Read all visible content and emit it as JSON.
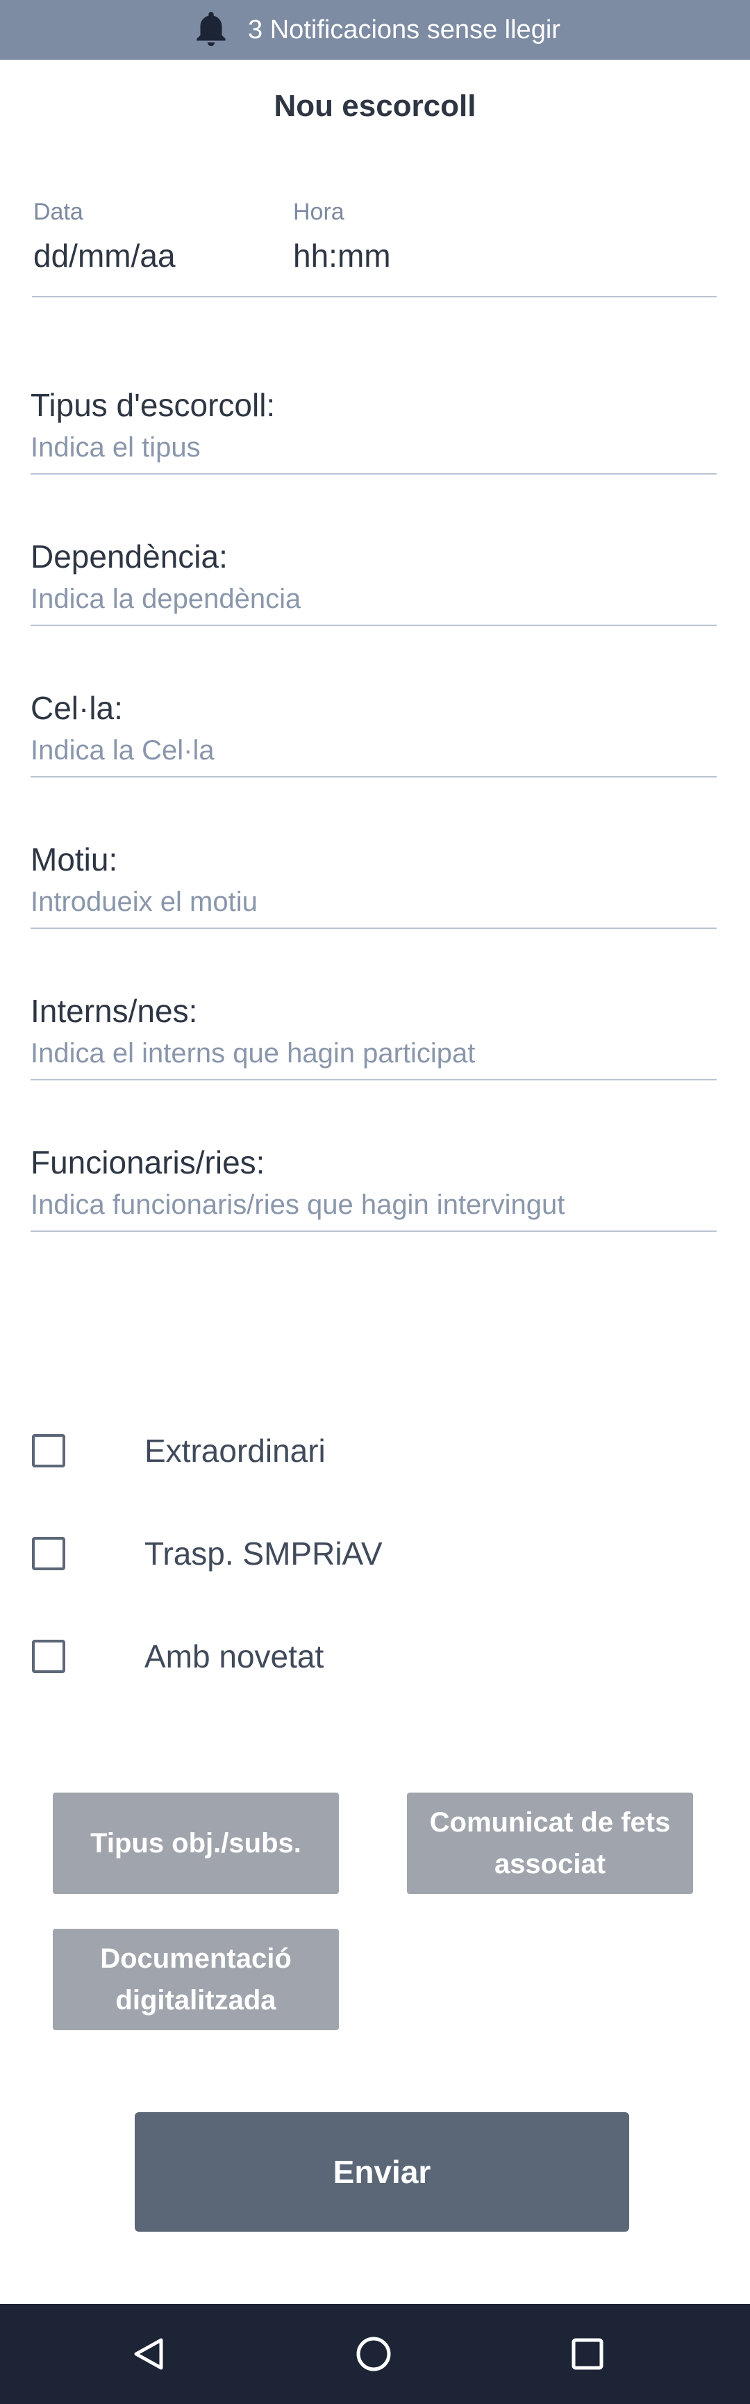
{
  "notification_bar": {
    "icon": "bell-icon",
    "text": "3 Notificacions sense llegir"
  },
  "page_title": "Nou escorcoll",
  "datetime": {
    "date_label": "Data",
    "date_value": "dd/mm/aa",
    "time_label": "Hora",
    "time_value": "hh:mm"
  },
  "fields": [
    {
      "label": "Tipus d'escorcoll:",
      "placeholder": "Indica el tipus"
    },
    {
      "label": "Dependència:",
      "placeholder": "Indica la dependència"
    },
    {
      "label": "Cel·la:",
      "placeholder": "Indica la Cel·la"
    },
    {
      "label": "Motiu:",
      "placeholder": "Introdueix el motiu"
    },
    {
      "label": "Interns/nes:",
      "placeholder": "Indica el interns que hagin participat"
    },
    {
      "label": "Funcionaris/ries:",
      "placeholder": "Indica funcionaris/ries que hagin intervingut"
    }
  ],
  "checkboxes": [
    {
      "label": "Extraordinari",
      "checked": false
    },
    {
      "label": "Trasp. SMPRiAV",
      "checked": false
    },
    {
      "label": "Amb novetat",
      "checked": false
    }
  ],
  "buttons": {
    "object_type": "Tipus obj./subs.",
    "report": "Comunicat de fets associat",
    "documentation": "Documentació digitalitzada",
    "send": "Enviar"
  },
  "nav_bar": {
    "back_icon": "back-triangle-icon",
    "home_icon": "home-circle-icon",
    "recents_icon": "recents-square-icon"
  },
  "colors": {
    "notification_bg": "#7d8ba3",
    "secondary_button_bg": "#a0a5ad",
    "primary_button_bg": "#5b6777",
    "nav_bar_bg": "#1c2435"
  }
}
